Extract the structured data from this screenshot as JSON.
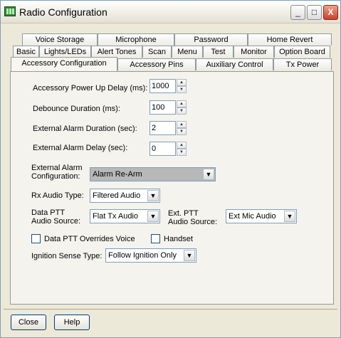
{
  "window": {
    "title": "Radio Configuration",
    "controls": {
      "minimize": "_",
      "maximize": "□",
      "close": "X"
    }
  },
  "tabs": {
    "row1": [
      "Voice Storage",
      "Microphone",
      "Password",
      "Home Revert"
    ],
    "row2": [
      "Basic",
      "Lights/LEDs",
      "Alert Tones",
      "Scan",
      "Menu",
      "Test",
      "Monitor",
      "Option Board"
    ],
    "row3": [
      "Accessory Configuration",
      "Accessory Pins",
      "Auxiliary Control",
      "Tx Power"
    ],
    "active": "Accessory Configuration"
  },
  "form": {
    "power_up_delay": {
      "label": "Accessory Power Up Delay (ms):",
      "value": "1000"
    },
    "debounce": {
      "label": "Debounce Duration (ms):",
      "value": "100"
    },
    "alarm_duration": {
      "label": "External Alarm Duration (sec):",
      "value": "2"
    },
    "alarm_delay": {
      "label": "External Alarm Delay (sec):",
      "value": "0"
    },
    "alarm_config": {
      "label_line1": "External Alarm",
      "label_line2": "Configuration:",
      "value": "Alarm Re-Arm"
    },
    "rx_audio": {
      "label": "Rx Audio Type:",
      "value": "Filtered Audio"
    },
    "data_ptt": {
      "label_line1": "Data PTT",
      "label_line2": "Audio Source:",
      "value": "Flat Tx Audio"
    },
    "ext_ptt": {
      "label_line1": "Ext. PTT",
      "label_line2": "Audio Source:",
      "value": "Ext Mic Audio"
    },
    "data_ptt_overrides": {
      "label": "Data PTT Overrides Voice",
      "checked": false
    },
    "handset": {
      "label": "Handset",
      "checked": false
    },
    "ignition": {
      "label": "Ignition Sense Type:",
      "value": "Follow Ignition Only"
    }
  },
  "buttons": {
    "close": "Close",
    "help": "Help"
  },
  "colors": {
    "window_bg": "#ece9d8",
    "panel_bg": "#f4f3ee",
    "border_blue": "#7f9db9",
    "close_red": "#c8402a",
    "icon_green": "#2e8b2e"
  },
  "icons": {
    "spin_up": "▲",
    "spin_down": "▼",
    "dropdown": "▼"
  }
}
